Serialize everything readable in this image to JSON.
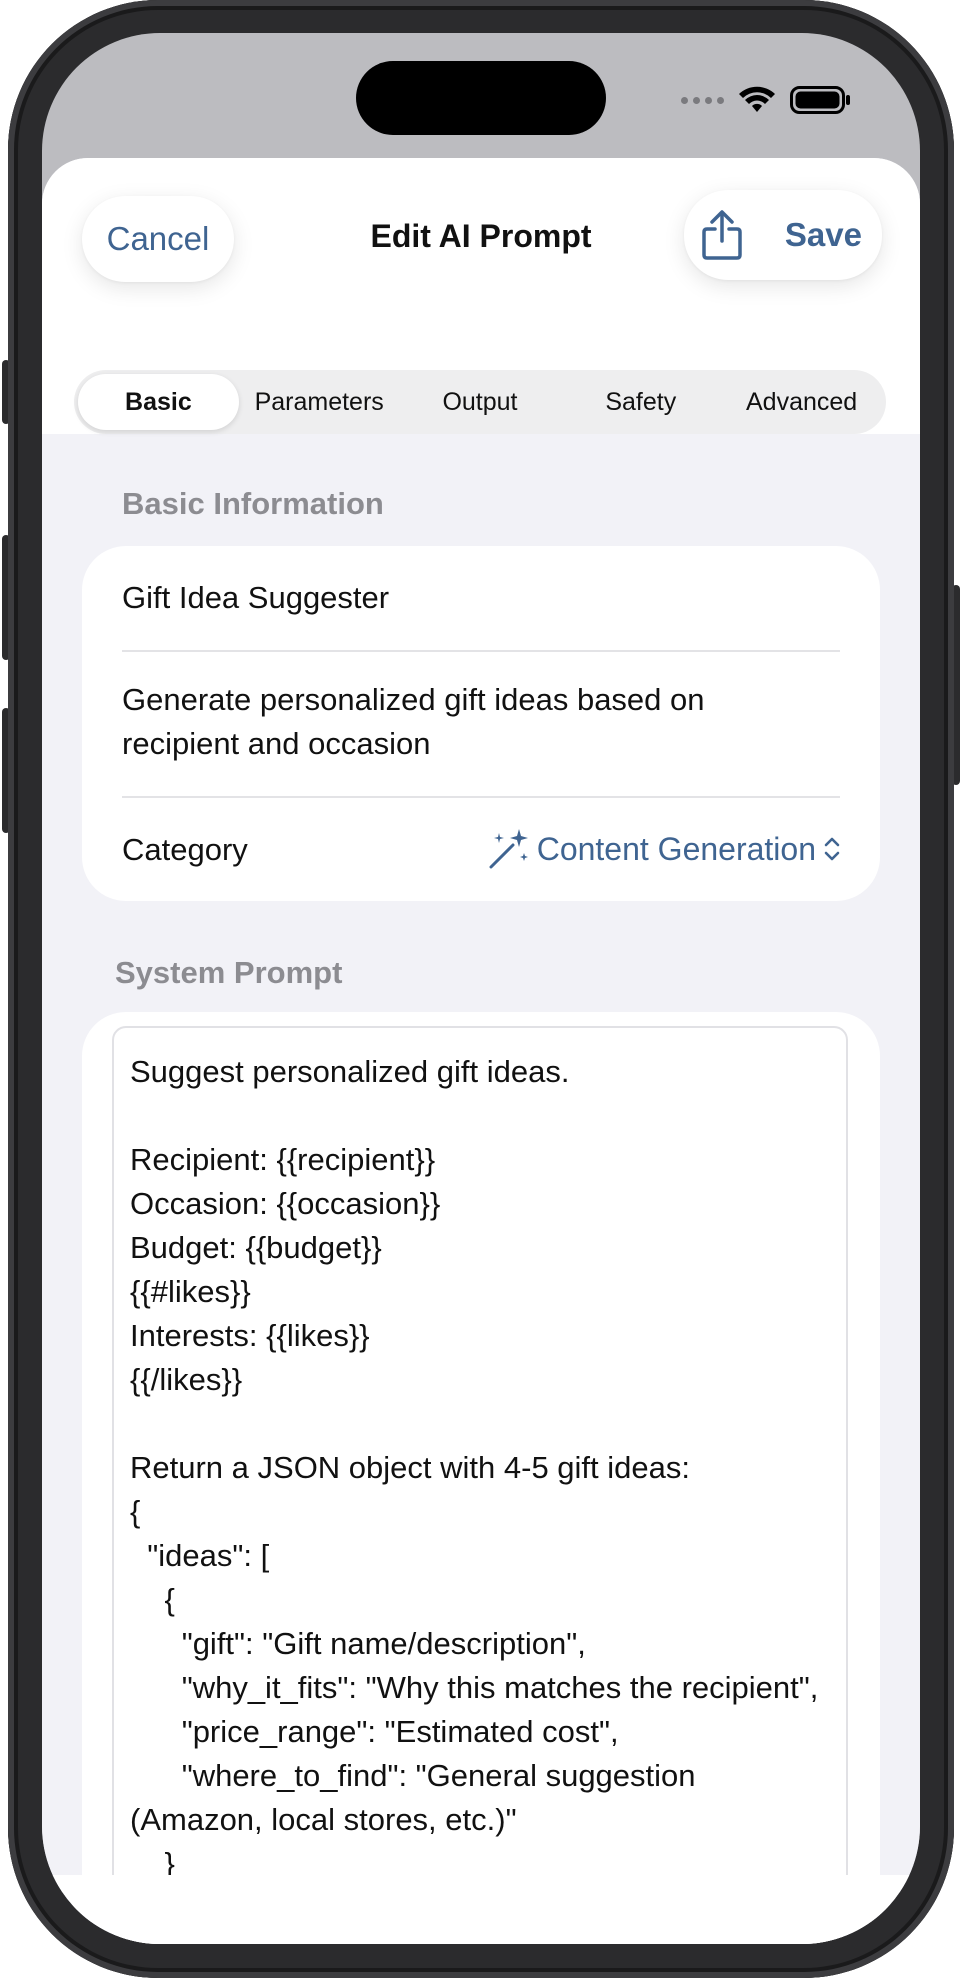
{
  "header": {
    "cancel_label": "Cancel",
    "title": "Edit AI Prompt",
    "save_label": "Save"
  },
  "tabs": [
    {
      "label": "Basic",
      "selected": true
    },
    {
      "label": "Parameters",
      "selected": false
    },
    {
      "label": "Output",
      "selected": false
    },
    {
      "label": "Safety",
      "selected": false
    },
    {
      "label": "Advanced",
      "selected": false
    }
  ],
  "basic_info": {
    "section_label": "Basic Information",
    "name": "Gift Idea Suggester",
    "description": "Generate personalized gift ideas based on recipient and occasion",
    "category_label": "Category",
    "category_value": "Content Generation"
  },
  "system_prompt": {
    "section_label": "System Prompt",
    "text": "Suggest personalized gift ideas.\n\nRecipient: {{recipient}}\nOccasion: {{occasion}}\nBudget: {{budget}}\n{{#likes}}\nInterests: {{likes}}\n{{/likes}}\n\nReturn a JSON object with 4-5 gift ideas:\n{\n  \"ideas\": [\n    {\n      \"gift\": \"Gift name/description\",\n      \"why_it_fits\": \"Why this matches the recipient\",\n      \"price_range\": \"Estimated cost\",\n      \"where_to_find\": \"General suggestion (Amazon, local stores, etc.)\"\n    }"
  },
  "icons": {
    "share": "share-icon",
    "category": "magic-wand-icon",
    "picker": "chevron-up-down-icon",
    "wifi": "wifi-icon",
    "battery": "battery-icon"
  },
  "colors": {
    "accent": "#3f6491",
    "background": "#f2f2f7",
    "section_label": "#8c8c91"
  }
}
